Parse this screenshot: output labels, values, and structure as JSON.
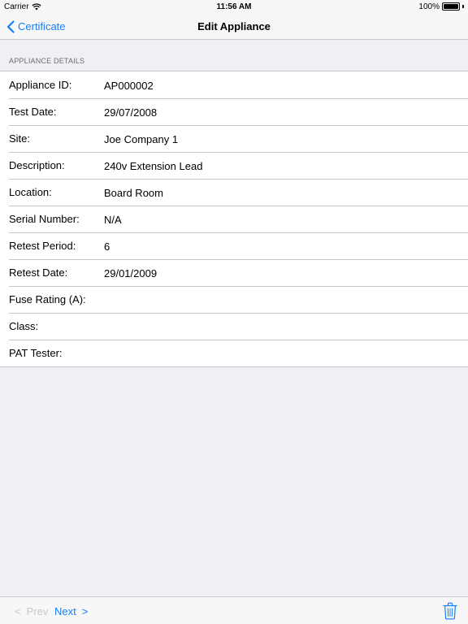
{
  "status_bar": {
    "carrier": "Carrier",
    "time": "11:56 AM",
    "battery": "100%"
  },
  "nav": {
    "back_label": "Certificate",
    "title": "Edit Appliance"
  },
  "section": {
    "header": "APPLIANCE DETAILS"
  },
  "fields": [
    {
      "label": "Appliance ID:",
      "value": "AP000002"
    },
    {
      "label": "Test Date:",
      "value": "29/07/2008"
    },
    {
      "label": "Site:",
      "value": "Joe Company 1"
    },
    {
      "label": "Description:",
      "value": "240v Extension Lead"
    },
    {
      "label": "Location:",
      "value": "Board Room"
    },
    {
      "label": "Serial Number:",
      "value": "N/A"
    },
    {
      "label": "Retest Period:",
      "value": "6"
    },
    {
      "label": "Retest Date:",
      "value": "29/01/2009"
    },
    {
      "label": "Fuse Rating (A):",
      "value": ""
    },
    {
      "label": "Class:",
      "value": ""
    },
    {
      "label": "PAT Tester:",
      "value": ""
    }
  ],
  "toolbar": {
    "prev_symbol": "<",
    "prev_label": "Prev",
    "next_label": "Next",
    "next_symbol": ">",
    "trash_icon": "trash-icon"
  },
  "colors": {
    "accent": "#147efb",
    "disabled": "#c7c7cc",
    "background": "#efeff4"
  }
}
